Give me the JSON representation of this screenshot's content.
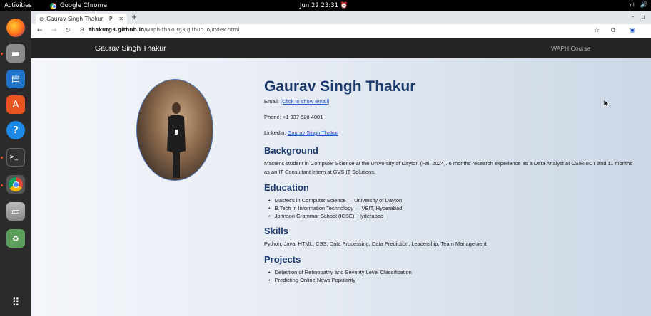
{
  "topbar": {
    "activities": "Activities",
    "app_name": "Google Chrome",
    "clock": "Jun 22  23:31"
  },
  "dock": {
    "items": [
      "firefox-icon",
      "files-icon",
      "writer-icon",
      "software-icon",
      "help-icon",
      "terminal-icon",
      "chrome-icon",
      "disk-icon",
      "trash-icon",
      "apps-grid-icon"
    ]
  },
  "browser": {
    "tab_title": "Gaurav Singh Thakur – P",
    "url_host": "thakurg3.github.io",
    "url_path": "/waph-thakurg3.github.io/index.html"
  },
  "site": {
    "brand": "Gaurav Singh Thakur",
    "nav_link": "WAPH Course",
    "name": "Gaurav Singh Thakur",
    "email_label": "Email: ",
    "email_link": "[Click to show email]",
    "phone": "Phone: +1 937 520 4001",
    "linkedin_label": "LinkedIn: ",
    "linkedin_link": "Gaurav Singh Thakur",
    "background_heading": "Background",
    "background_text": "Master's student in Computer Science at the University of Dayton (Fall 2024). 6 months research experience as a Data Analyst at CSIR-IICT and 11 months as an IT Consultant Intern at GVS IT Solutions.",
    "education_heading": "Education",
    "education": [
      "Master's in Computer Science — University of Dayton",
      "B.Tech in Information Technology — VBIT, Hyderabad",
      "Johnson Grammar School (ICSE), Hyderabad"
    ],
    "skills_heading": "Skills",
    "skills_text": "Python, Java, HTML, CSS, Data Processing, Data Prediction, Leadership, Team Management",
    "projects_heading": "Projects",
    "projects": [
      "Detection of Retinopathy and Severity Level Classification",
      "Predicting Online News Popularity"
    ]
  }
}
